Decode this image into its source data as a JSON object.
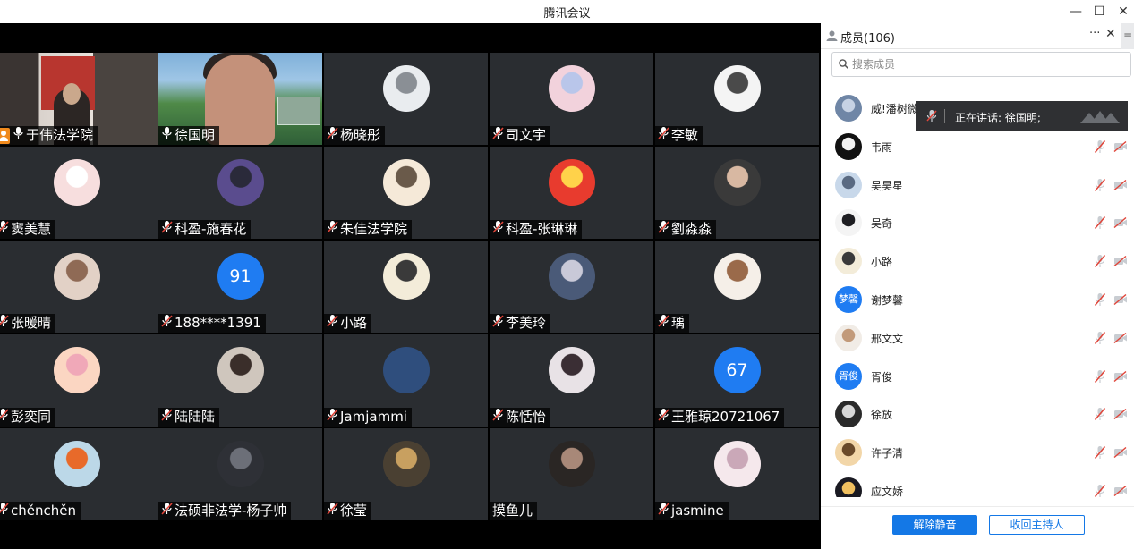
{
  "window": {
    "title": "腾讯会议",
    "minimize": "—",
    "maximize": "☐",
    "close": "✕"
  },
  "tiles": [
    {
      "name": "于伟法学院",
      "kind": "video-a",
      "host": true,
      "mic": "on"
    },
    {
      "name": "徐国明",
      "kind": "video-b",
      "mic": "on",
      "active": true
    },
    {
      "name": "杨晓彤",
      "kind": "photo",
      "colors": [
        "#e9ecef",
        "#8a8f95"
      ],
      "mic": "off"
    },
    {
      "name": "司文宇",
      "kind": "photo",
      "colors": [
        "#f2d2dc",
        "#b9c6ea"
      ],
      "mic": "off"
    },
    {
      "name": "李敏",
      "kind": "photo",
      "colors": [
        "#f4f4f4",
        "#4a4a4a"
      ],
      "mic": "off"
    },
    {
      "name": "窦美慧",
      "kind": "photo",
      "colors": [
        "#f7dede",
        "#ffffff"
      ],
      "mic": "off"
    },
    {
      "name": "科盈-施春花",
      "kind": "photo",
      "colors": [
        "#5a4c8e",
        "#2a2a3a"
      ],
      "mic": "off"
    },
    {
      "name": "朱佳法学院",
      "kind": "photo",
      "colors": [
        "#f5e9d8",
        "#6a5a4a"
      ],
      "mic": "off"
    },
    {
      "name": "科盈-张琳琳",
      "kind": "photo",
      "colors": [
        "#e83b2e",
        "#ffd24a"
      ],
      "mic": "off"
    },
    {
      "name": "劉淼淼",
      "kind": "photo",
      "colors": [
        "#3a3a3a",
        "#d8b8a2"
      ],
      "mic": "off"
    },
    {
      "name": "张暖晴",
      "kind": "photo",
      "colors": [
        "#e2d1c6",
        "#8f6a55"
      ],
      "mic": "off"
    },
    {
      "name": "188****1391",
      "kind": "number",
      "label": "91",
      "mic": "off"
    },
    {
      "name": "小路",
      "kind": "photo",
      "colors": [
        "#f3ecd9",
        "#3a3a3a"
      ],
      "mic": "off"
    },
    {
      "name": "李美玲",
      "kind": "photo",
      "colors": [
        "#4a5a78",
        "#c9c9d8"
      ],
      "mic": "off"
    },
    {
      "name": "瑀",
      "kind": "photo",
      "colors": [
        "#f5efe8",
        "#9a6a4a"
      ],
      "mic": "off"
    },
    {
      "name": "彭奕同",
      "kind": "photo",
      "colors": [
        "#fbd6c2",
        "#f0a8b8"
      ],
      "mic": "off"
    },
    {
      "name": "陆陆陆",
      "kind": "photo",
      "colors": [
        "#cfc6bd",
        "#3a2e2a"
      ],
      "mic": "off"
    },
    {
      "name": "Jamjammi",
      "kind": "plain",
      "mic": "off"
    },
    {
      "name": "陈恬怡",
      "kind": "photo",
      "colors": [
        "#e8e2e6",
        "#3a2e34"
      ],
      "mic": "off"
    },
    {
      "name": "王雅琼20721067",
      "kind": "number",
      "label": "67",
      "mic": "off"
    },
    {
      "name": "chěnchěn",
      "kind": "photo",
      "colors": [
        "#bcd8e8",
        "#e86a2a"
      ],
      "mic": "off"
    },
    {
      "name": "法硕非法学-杨子帅",
      "kind": "photo",
      "colors": [
        "#2e3036",
        "#6c6f78"
      ],
      "mic": "off"
    },
    {
      "name": "徐莹",
      "kind": "photo",
      "colors": [
        "#4a4032",
        "#c8a060"
      ],
      "mic": "off"
    },
    {
      "name": "摸鱼儿",
      "kind": "photo",
      "colors": [
        "#2a2624",
        "#a88878"
      ],
      "mic": "none"
    },
    {
      "name": "jasmine",
      "kind": "photo",
      "colors": [
        "#f5e8ec",
        "#caa8b8"
      ],
      "mic": "off"
    }
  ],
  "panel": {
    "title": "成员(106)",
    "more": "···",
    "close": "✕",
    "side": "≡",
    "search_placeholder": "搜索成员",
    "speaking_label": "正在讲话: 徐国明;",
    "members": [
      {
        "name": "威!潘树微",
        "colors": [
          "#6f86a6",
          "#c6d2e4"
        ]
      },
      {
        "name": "韦雨",
        "colors": [
          "#111111",
          "#f0f0f0"
        ]
      },
      {
        "name": "吴昊星",
        "colors": [
          "#c8d8ea",
          "#5a6a82"
        ]
      },
      {
        "name": "吴奇",
        "colors": [
          "#f4f4f4",
          "#1e1e22"
        ]
      },
      {
        "name": "小路",
        "colors": [
          "#f3ecd9",
          "#3a3a3a"
        ]
      },
      {
        "name": "谢梦馨",
        "avatar_text": "梦馨"
      },
      {
        "name": "邢文文",
        "colors": [
          "#f1ece6",
          "#c29a7a"
        ]
      },
      {
        "name": "胥俊",
        "avatar_text": "胥俊"
      },
      {
        "name": "徐放",
        "colors": [
          "#2a2a2a",
          "#d8d8d8"
        ]
      },
      {
        "name": "许子清",
        "colors": [
          "#f2d6a8",
          "#6a4a2a"
        ]
      },
      {
        "name": "应文娇",
        "colors": [
          "#1a1a22",
          "#f0c060"
        ]
      }
    ],
    "unmute_all": "解除静音",
    "reclaim_host": "收回主持人"
  }
}
